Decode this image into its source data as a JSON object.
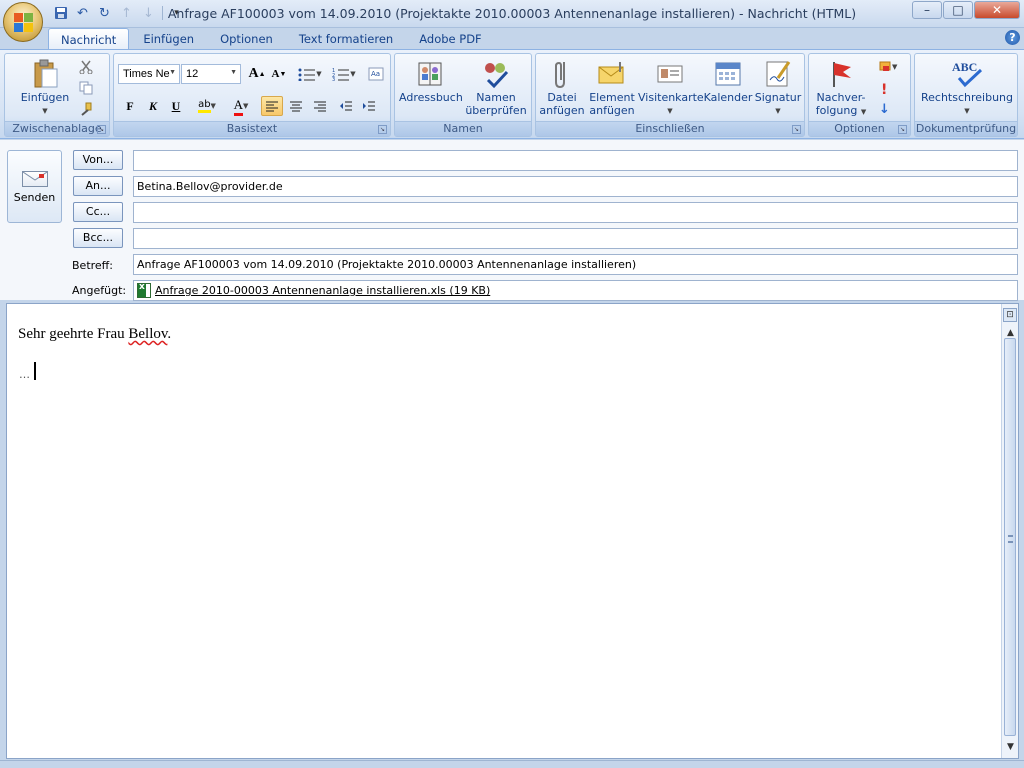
{
  "window": {
    "title": "Anfrage AF100003 vom 14.09.2010 (Projektakte 2010.00003 Antennenanlage installieren) - Nachricht (HTML)",
    "minimize": "–",
    "maximize": "□",
    "close": "✕"
  },
  "qat": {
    "save": "💾",
    "undo": "↶",
    "redo": "↻",
    "prev": "↑",
    "next": "↓",
    "more": "▾"
  },
  "tabs": [
    "Nachricht",
    "Einfügen",
    "Optionen",
    "Text formatieren",
    "Adobe PDF"
  ],
  "help": "?",
  "ribbon": {
    "groups": {
      "zwischenablage": "Zwischenablage",
      "basistext": "Basistext",
      "namen": "Namen",
      "einschliessen": "Einschließen",
      "optionen": "Optionen",
      "dokumentpruefung": "Dokumentprüfung"
    },
    "paste": "Einfügen",
    "font_name": "Times Ne",
    "font_size": "12",
    "bold": "F",
    "italic": "K",
    "underline": "U",
    "highlight": "ab",
    "font_color": "A",
    "adressbuch": "Adressbuch",
    "namen_pruefen_1": "Namen",
    "namen_pruefen_2": "überprüfen",
    "datei_1": "Datei",
    "datei_2": "anfügen",
    "element_1": "Element",
    "element_2": "anfügen",
    "visitenkarte": "Visitenkarte",
    "kalender": "Kalender",
    "signatur": "Signatur",
    "nachverfolgung_1": "Nachver-",
    "nachverfolgung_2": "folgung",
    "rechtschreibung": "Rechtschreibung",
    "abc": "ABC"
  },
  "header": {
    "send": "Senden",
    "von": "Von...",
    "an": "An...",
    "cc": "Cc...",
    "bcc": "Bcc...",
    "betreff_label": "Betreff:",
    "angefuegt_label": "Angefügt:",
    "von_value": "",
    "an_value": "Betina.Bellov@provider.de",
    "cc_value": "",
    "bcc_value": "",
    "betreff_value": "Anfrage AF100003 vom 14.09.2010 (Projektakte 2010.00003 Antennenanlage installieren)",
    "attachment": "Anfrage 2010-00003 Antennenanlage installieren.xls (19 KB)"
  },
  "body": {
    "greeting_prefix": "Sehr geehrte Frau ",
    "greeting_name": "Bellov",
    "greeting_suffix": "."
  },
  "colors": {
    "ribbon": "#dde8f6",
    "accent": "#15428b",
    "close": "#c84a2c"
  }
}
